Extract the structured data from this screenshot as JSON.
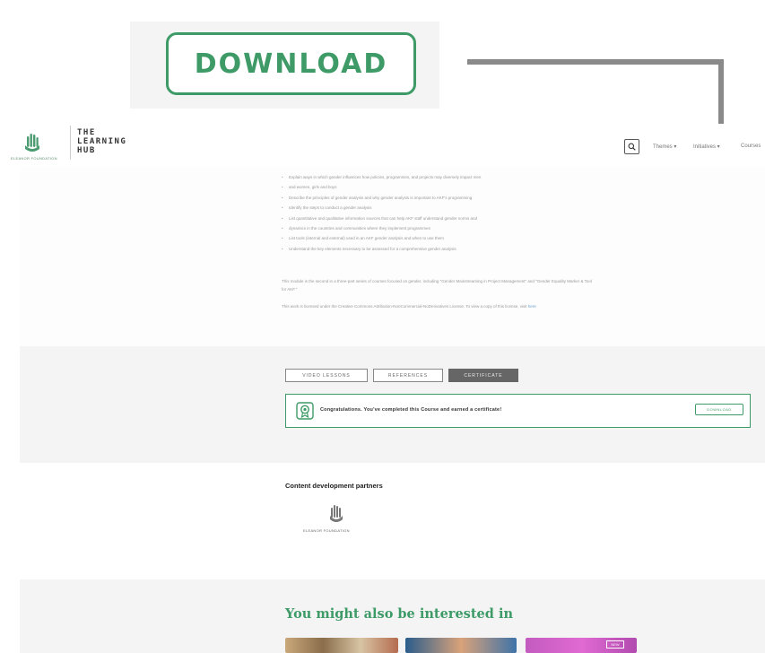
{
  "callout": {
    "download_label": "DOWNLOAD"
  },
  "header": {
    "logo_text": "THE\nLEARNING\nHUB",
    "logo_org": "ELEANOR FOUNDATION",
    "nav": [
      "Themes ▾",
      "Initiatives ▾",
      "Courses"
    ]
  },
  "course": {
    "bullets": [
      "Explain ways in which gender influences how policies, programmes, and projects may diversely impact men",
      "and women, girls and boys",
      "Describe the principles of gender analysis and why gender analysis is important to AKF's programming",
      "Identify the steps to conduct a gender analysis",
      "List quantitative and qualitative information sources that can help AKF staff understand gender norms and",
      "dynamics in the countries and communities where they implement programmes",
      "List tools (internal and external) used in an AKF gender analysis and when to use them",
      "Understand the key elements necessary to be assessed for a comprehensive gender analysis"
    ],
    "para1": "This module is the second in a three-part series of courses focused on gender, including \"Gender Mainstreaming in Project Management\" and \"Gender Equality Marker & Tool for AKF.\"",
    "para2_prefix": "This work is licensed under the Creative Commons Attribution-NonCommercial-NoDerivatives License. To view a copy of this license, visit",
    "para2_link": "here"
  },
  "tabs": [
    "VIDEO LESSONS",
    "REFERENCES",
    "CERTIFICATE"
  ],
  "certificate": {
    "message": "Congratulations. You've completed this Course and earned a certificate!",
    "download_label": "DOWNLOAD"
  },
  "partners": {
    "title": "Content development partners",
    "partner_name": "ELEANOR FOUNDATION"
  },
  "interest": {
    "title": "You might also be interested in",
    "badge": "NEW"
  },
  "colors": {
    "accent": "#3e9b67",
    "connector": "#8a8a8a"
  }
}
